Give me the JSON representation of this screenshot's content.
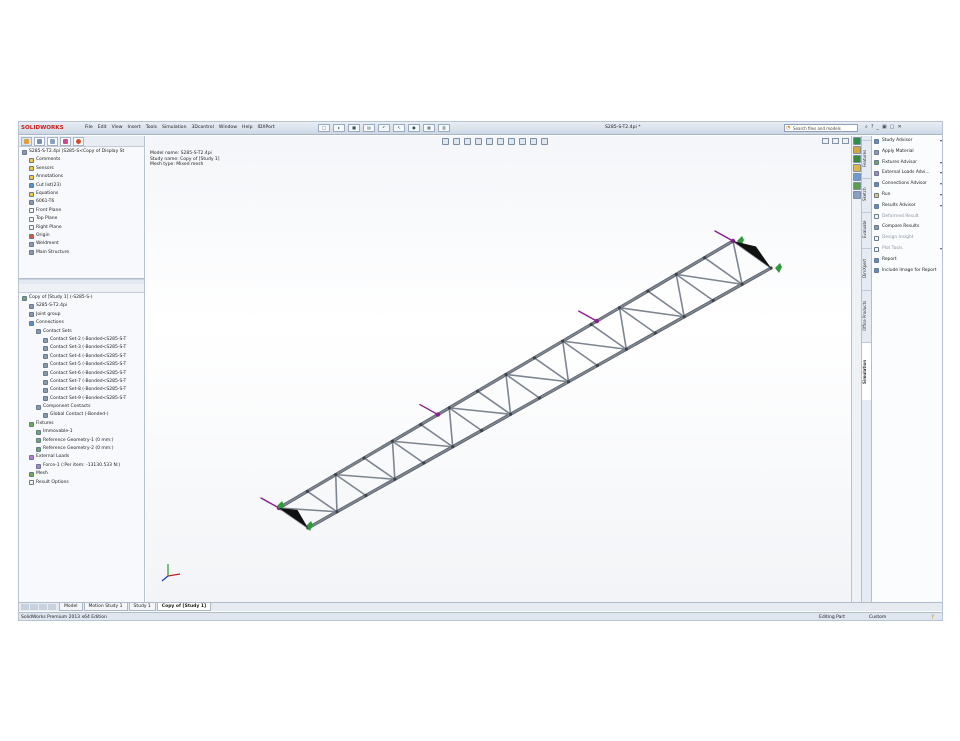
{
  "titlebar": {
    "logo": "SOLIDWORKS",
    "menus": [
      "File",
      "Edit",
      "View",
      "Insert",
      "Tools",
      "Simulation",
      "3Dcontrol",
      "Window",
      "Help",
      "IDXPort"
    ],
    "document_title": "S285-S-T2.4pi *",
    "search_placeholder": "Search files and models"
  },
  "feature_manager": {
    "part_tree": [
      {
        "label": "S285-S-T2.4pi  (S285-S<Copy of Display St",
        "icon": "part-icon",
        "color": "gr",
        "indent": 0
      },
      {
        "label": "Comments",
        "icon": "folder-icon",
        "color": "y",
        "indent": 1
      },
      {
        "label": "Sensors",
        "icon": "folder-icon",
        "color": "y",
        "indent": 1
      },
      {
        "label": "Annotations",
        "icon": "annotation-icon",
        "color": "y",
        "indent": 1
      },
      {
        "label": "Cut list(23)",
        "icon": "cutlist-icon",
        "color": "b",
        "indent": 1
      },
      {
        "label": "Equations",
        "icon": "equation-icon",
        "color": "y",
        "indent": 1
      },
      {
        "label": "6061-T6",
        "icon": "material-icon",
        "color": "gr",
        "indent": 1
      },
      {
        "label": "Front Plane",
        "icon": "plane-icon",
        "color": "w",
        "indent": 1
      },
      {
        "label": "Top Plane",
        "icon": "plane-icon",
        "color": "w",
        "indent": 1
      },
      {
        "label": "Right Plane",
        "icon": "plane-icon",
        "color": "w",
        "indent": 1
      },
      {
        "label": "Origin",
        "icon": "origin-icon",
        "color": "r",
        "indent": 1
      },
      {
        "label": "Weldment",
        "icon": "weldment-icon",
        "color": "gr",
        "indent": 1
      },
      {
        "label": "Main Structure",
        "icon": "structure-icon",
        "color": "gr",
        "indent": 1
      }
    ],
    "study_tree": [
      {
        "label": "Copy of [Study 1] (-S285-S-)",
        "icon": "study-icon",
        "color": "g",
        "indent": 0
      },
      {
        "label": "S285-S-T2.4pi",
        "icon": "part-icon",
        "color": "gr",
        "indent": 1
      },
      {
        "label": "Joint group",
        "icon": "joint-icon",
        "color": "gr",
        "indent": 1
      },
      {
        "label": "Connections",
        "icon": "connections-icon",
        "color": "b",
        "indent": 1
      },
      {
        "label": "Contact Sets",
        "icon": "contact-icon",
        "color": "gr",
        "indent": 2
      },
      {
        "label": "Contact Set-2 (-Bonded<S285-S-T",
        "icon": "contact-set-icon",
        "color": "gr",
        "indent": 3
      },
      {
        "label": "Contact Set-3 (-Bonded<S285-S-T",
        "icon": "contact-set-icon",
        "color": "gr",
        "indent": 3
      },
      {
        "label": "Contact Set-4 (-Bonded<S285-S-T",
        "icon": "contact-set-icon",
        "color": "gr",
        "indent": 3
      },
      {
        "label": "Contact Set-5 (-Bonded<S285-S-T",
        "icon": "contact-set-icon",
        "color": "gr",
        "indent": 3
      },
      {
        "label": "Contact Set-6 (-Bonded<S285-S-T",
        "icon": "contact-set-icon",
        "color": "gr",
        "indent": 3
      },
      {
        "label": "Contact Set-7 (-Bonded<S285-S-T",
        "icon": "contact-set-icon",
        "color": "gr",
        "indent": 3
      },
      {
        "label": "Contact Set-8 (-Bonded<S285-S-T",
        "icon": "contact-set-icon",
        "color": "gr",
        "indent": 3
      },
      {
        "label": "Contact Set-9 (-Bonded<S285-S-T",
        "icon": "contact-set-icon",
        "color": "gr",
        "indent": 3
      },
      {
        "label": "Component Contacts",
        "icon": "component-contact-icon",
        "color": "gr",
        "indent": 2
      },
      {
        "label": "Global Contact (-Bonded-)",
        "icon": "global-contact-icon",
        "color": "gr",
        "indent": 3
      },
      {
        "label": "Fixtures",
        "icon": "fixtures-icon",
        "color": "g",
        "indent": 1
      },
      {
        "label": "Immovable-1",
        "icon": "immovable-icon",
        "color": "g",
        "indent": 2
      },
      {
        "label": "Reference Geometry-1 (0 mm:)",
        "icon": "ref-geometry-icon",
        "color": "g",
        "indent": 2
      },
      {
        "label": "Reference Geometry-2 (0 mm:)",
        "icon": "ref-geometry-icon",
        "color": "g",
        "indent": 2
      },
      {
        "label": "External Loads",
        "icon": "loads-icon",
        "color": "p",
        "indent": 1
      },
      {
        "label": "Force-1 (:Per item: -13130.533 N:)",
        "icon": "force-icon",
        "color": "p",
        "indent": 2
      },
      {
        "label": "Mesh",
        "icon": "mesh-icon",
        "color": "g",
        "indent": 1
      },
      {
        "label": "Result Options",
        "icon": "result-options-icon",
        "color": "w",
        "indent": 1
      }
    ]
  },
  "viewport": {
    "info_lines": [
      "Model name: S285-S-T2.4pi",
      "Study name: Copy of [Study 1]",
      "Mesh type: Mixed mesh"
    ]
  },
  "advisor": {
    "items": [
      {
        "label": "Study Advisor",
        "icon": "magnifier-icon",
        "color": "b",
        "sub": false,
        "arrow": true
      },
      {
        "label": "Apply Material",
        "icon": "material-icon",
        "color": "gr",
        "sub": false,
        "arrow": false
      },
      {
        "label": "Fixtures Advisor",
        "icon": "fixtures-icon",
        "color": "g",
        "sub": false,
        "arrow": true
      },
      {
        "label": "External Loads Advi...",
        "icon": "loads-icon",
        "color": "p",
        "sub": false,
        "arrow": true
      },
      {
        "label": "Connections Advisor",
        "icon": "connections-icon",
        "color": "b",
        "sub": false,
        "arrow": true
      },
      {
        "label": "Run",
        "icon": "run-icon",
        "color": "y",
        "sub": false,
        "arrow": true
      },
      {
        "label": "Results Advisor",
        "icon": "results-icon",
        "color": "b",
        "sub": false,
        "arrow": true
      },
      {
        "label": "Deformed Result",
        "icon": "deformed-icon",
        "color": "w",
        "sub": true,
        "arrow": false
      },
      {
        "label": "Compare Results",
        "icon": "compare-icon",
        "color": "gr",
        "sub": false,
        "arrow": false
      },
      {
        "label": "Design Insight",
        "icon": "insight-icon",
        "color": "w",
        "sub": true,
        "arrow": false
      },
      {
        "label": "Plot Tools",
        "icon": "plot-tools-icon",
        "color": "w",
        "sub": true,
        "arrow": true
      },
      {
        "label": "Report",
        "icon": "report-icon",
        "color": "b",
        "sub": false,
        "arrow": false
      },
      {
        "label": "Include Image for Report",
        "icon": "image-report-icon",
        "color": "b",
        "sub": false,
        "arrow": false
      }
    ],
    "vertical_tabs": [
      "Features",
      "Sketch",
      "Evaluate",
      "DimXpert",
      "Office Products",
      "Simulation"
    ]
  },
  "bottom_tabs": [
    "Model",
    "Motion Study 1",
    "Study 1",
    "Copy of [Study 1]"
  ],
  "statusbar": {
    "edition": "SolidWorks Premium 2013 x64 Edition",
    "mode": "Editing Part",
    "units": "Custom",
    "help": "?"
  },
  "colors": {
    "truss": "#7d8590",
    "truss_dark": "#4f555d",
    "force_arrow": "#8a1b8f",
    "fixture": "#2e9a3a",
    "brand": "#c8201c"
  }
}
